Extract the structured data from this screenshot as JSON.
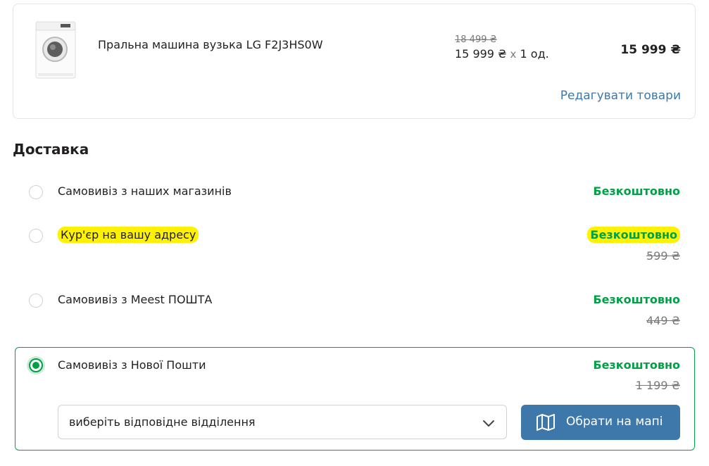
{
  "cart_item": {
    "name": "Пральна машина вузька LG F2J3HS0W",
    "old_price": "18 499 ₴",
    "unit_price": "15 999 ₴",
    "times": "x",
    "quantity": "1 од.",
    "total": "15 999 ₴",
    "edit_link": "Редагувати товари"
  },
  "delivery": {
    "title": "Доставка",
    "options": [
      {
        "label": "Самовивіз з наших магазинів",
        "price_label": "Безкоштовно",
        "old_price": null,
        "selected": false,
        "highlighted": false
      },
      {
        "label": "Кур'єр на вашу адресу",
        "price_label": "Безкоштовно",
        "old_price": "599 ₴",
        "selected": false,
        "highlighted": true
      },
      {
        "label": "Самовивіз з Meest ПОШТА",
        "price_label": "Безкоштовно",
        "old_price": "449 ₴",
        "selected": false,
        "highlighted": false
      },
      {
        "label": "Самовивіз з Нової Пошти",
        "price_label": "Безкоштовно",
        "old_price": "1 199 ₴",
        "selected": true,
        "highlighted": false
      }
    ],
    "branch_select": {
      "value": "виберіть відповідне відділення",
      "icon": "chevron-down-icon"
    },
    "map_button": {
      "label": "Обрати на мапі",
      "icon": "map-icon"
    }
  },
  "colors": {
    "accent_green": "#00a046",
    "link_blue": "#3e77aa",
    "highlight_yellow": "#fff200",
    "muted_gray": "#797878"
  }
}
